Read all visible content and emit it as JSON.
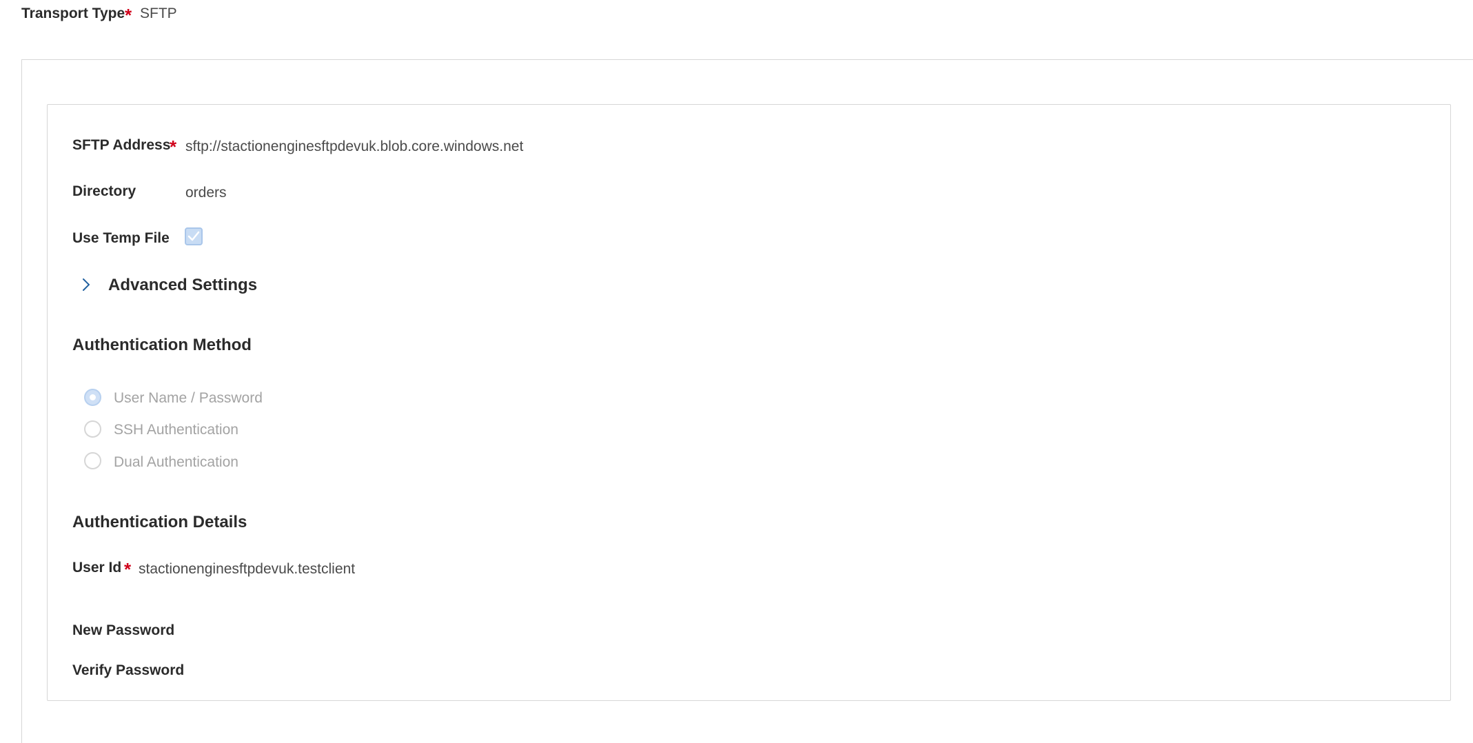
{
  "transport": {
    "label": "Transport Type",
    "required_mark": "*",
    "value": "SFTP"
  },
  "sftp": {
    "address_label": "SFTP Address",
    "address_required_mark": "*",
    "address_value": "sftp://stactionenginesftpdevuk.blob.core.windows.net",
    "directory_label": "Directory",
    "directory_value": "orders",
    "temp_file_label": "Use Temp File",
    "temp_file_checked": true,
    "advanced_settings_label": "Advanced Settings"
  },
  "auth_method": {
    "title": "Authentication Method",
    "options": [
      {
        "label": "User Name / Password",
        "selected": true
      },
      {
        "label": "SSH Authentication",
        "selected": false
      },
      {
        "label": "Dual Authentication",
        "selected": false
      }
    ]
  },
  "auth_details": {
    "title": "Authentication Details",
    "user_id_label": "User Id",
    "user_id_required_mark": "*",
    "user_id_value": "stactionenginesftpdevuk.testclient",
    "new_password_label": "New Password",
    "verify_password_label": "Verify Password"
  },
  "colors": {
    "required": "#d0021b",
    "accent": "#1f5f9e",
    "checkbox_fill": "#c8dcf4"
  },
  "icons": {
    "advanced_toggle": "chevron-right-icon",
    "temp_file_check": "checkmark-icon"
  }
}
